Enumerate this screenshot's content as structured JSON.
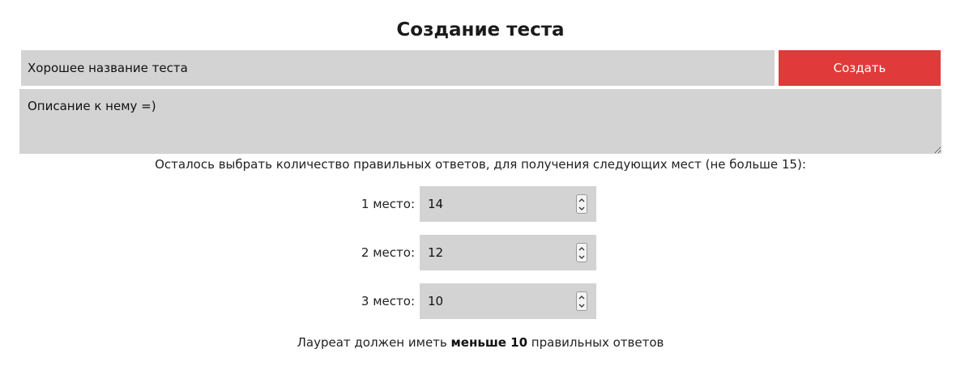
{
  "page": {
    "title": "Создание теста"
  },
  "form": {
    "name_value": "Хорошее название теста",
    "create_label": "Создать",
    "description_value": "Описание к нему =)"
  },
  "instruction": "Осталось выбрать количество правильных ответов, для получения следующих мест (не больше 15):",
  "places": [
    {
      "label": "1 место:",
      "value": "14"
    },
    {
      "label": "2 место:",
      "value": "12"
    },
    {
      "label": "3 место:",
      "value": "10"
    }
  ],
  "footer": {
    "prefix": "Лауреат должен иметь",
    "bold": "меньше 10",
    "suffix": "правильных ответов"
  },
  "colors": {
    "accent": "#e03a3a",
    "field_bg": "#d3d3d3"
  },
  "icons": {
    "spinner_up": "chevron-up-icon",
    "spinner_down": "chevron-down-icon"
  }
}
